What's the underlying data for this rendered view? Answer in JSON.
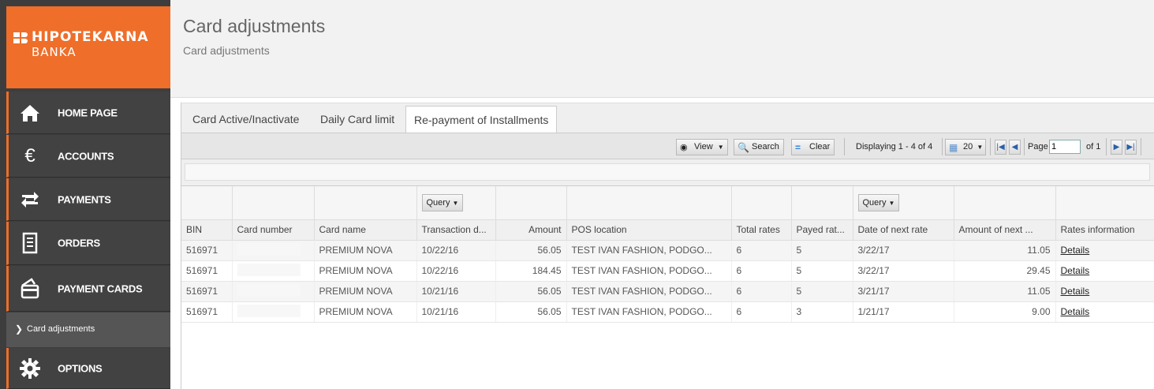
{
  "brand": {
    "line1": "HIPOTEKARNA",
    "line2": "BANKA",
    "color": "#ee6e2a"
  },
  "nav": {
    "home": "HOME PAGE",
    "accounts": "ACCOUNTS",
    "payments": "PAYMENTS",
    "orders": "ORDERS",
    "payment_cards": "PAYMENT CARDS",
    "card_adjustments": "Card adjustments",
    "options": "OPTIONS"
  },
  "header": {
    "title": "Card adjustments",
    "subtitle": "Card adjustments"
  },
  "tabs": [
    "Card Active/Inactivate",
    "Daily Card limit",
    "Re-payment of Installments"
  ],
  "toolbar": {
    "view": "View",
    "search": "Search",
    "clear": "Clear",
    "displaying": "Displaying 1 - 4 of 4",
    "page_size": "20",
    "page_label": "Page",
    "page_value": "1",
    "of_label": "of 1"
  },
  "query_label": "Query",
  "columns": [
    "BIN",
    "Card number",
    "Card name",
    "Transaction d...",
    "Amount",
    "POS location",
    "Total rates",
    "Payed rat...",
    "Date of next rate",
    "Amount of next ...",
    "Rates information"
  ],
  "rows": [
    {
      "bin": "516971",
      "card_number": "",
      "card_name": "PREMIUM NOVA",
      "transaction_date": "10/22/16",
      "amount": "56.05",
      "pos_location": "TEST IVAN FASHION, PODGO...",
      "total_rates": "6",
      "payed_rates": "5",
      "next_rate_date": "3/22/17",
      "next_amount": "11.05",
      "rates_info": "Details"
    },
    {
      "bin": "516971",
      "card_number": "",
      "card_name": "PREMIUM NOVA",
      "transaction_date": "10/22/16",
      "amount": "184.45",
      "pos_location": "TEST IVAN FASHION, PODGO...",
      "total_rates": "6",
      "payed_rates": "5",
      "next_rate_date": "3/22/17",
      "next_amount": "29.45",
      "rates_info": "Details"
    },
    {
      "bin": "516971",
      "card_number": "",
      "card_name": "PREMIUM NOVA",
      "transaction_date": "10/21/16",
      "amount": "56.05",
      "pos_location": "TEST IVAN FASHION, PODGO...",
      "total_rates": "6",
      "payed_rates": "5",
      "next_rate_date": "3/21/17",
      "next_amount": "11.05",
      "rates_info": "Details"
    },
    {
      "bin": "516971",
      "card_number": "",
      "card_name": "PREMIUM NOVA",
      "transaction_date": "10/21/16",
      "amount": "56.05",
      "pos_location": "TEST IVAN FASHION, PODGO...",
      "total_rates": "6",
      "payed_rates": "3",
      "next_rate_date": "1/21/17",
      "next_amount": "9.00",
      "rates_info": "Details"
    }
  ]
}
